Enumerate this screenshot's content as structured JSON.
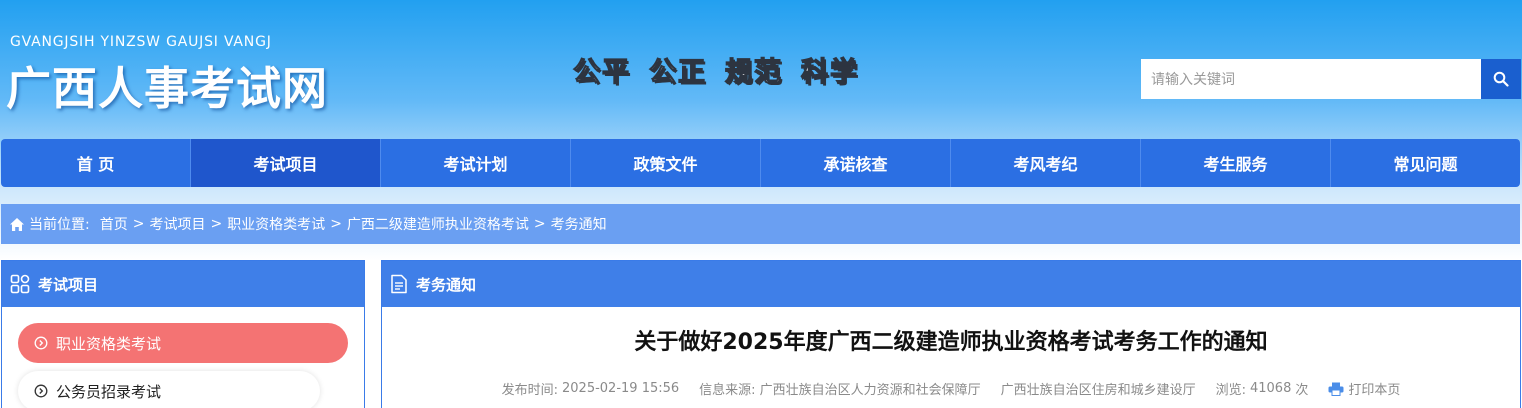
{
  "header": {
    "logo_en": "GVANGJSIH YINZSW GAUJSI VANGJ",
    "logo_cn": "广西人事考试网",
    "slogan": [
      "公平",
      "公正",
      "规范",
      "科学"
    ],
    "search": {
      "placeholder": "请输入关键词",
      "icon": "search-icon"
    }
  },
  "nav": {
    "items": [
      {
        "label": "首 页"
      },
      {
        "label": "考试项目"
      },
      {
        "label": "考试计划"
      },
      {
        "label": "政策文件"
      },
      {
        "label": "承诺核查"
      },
      {
        "label": "考风考纪"
      },
      {
        "label": "考生服务"
      },
      {
        "label": "常见问题"
      }
    ],
    "active_index": 1
  },
  "breadcrumb": {
    "prefix": "当前位置:",
    "items": [
      "首页",
      "考试项目",
      "职业资格类考试",
      "广西二级建造师执业资格考试",
      "考务通知"
    ],
    "separator": ">"
  },
  "sidebar": {
    "title": "考试项目",
    "items": [
      {
        "label": "职业资格类考试",
        "active": true
      },
      {
        "label": "公务员招录考试",
        "active": false
      }
    ]
  },
  "content": {
    "section_title": "考务通知",
    "article_title": "关于做好2025年度广西二级建造师执业资格考试考务工作的通知",
    "meta": {
      "publish_label": "发布时间:",
      "publish_time": "2025-02-19 15:56",
      "source_label": "信息来源:",
      "source_1": "广西壮族自治区人力资源和社会保障厅",
      "source_2": "广西壮族自治区住房和城乡建设厅",
      "views_label": "浏览:",
      "views": "41068",
      "views_unit": "次",
      "print_label": "打印本页"
    }
  },
  "colors": {
    "header_top": "#22a0f0",
    "nav": "#2b6fe3",
    "nav_active": "#1f56cc",
    "breadcrumb": "#6a9ff2",
    "panel_head": "#3f7fe8",
    "sidebar_active": "#f47373",
    "search_button": "#1a5fcf"
  }
}
